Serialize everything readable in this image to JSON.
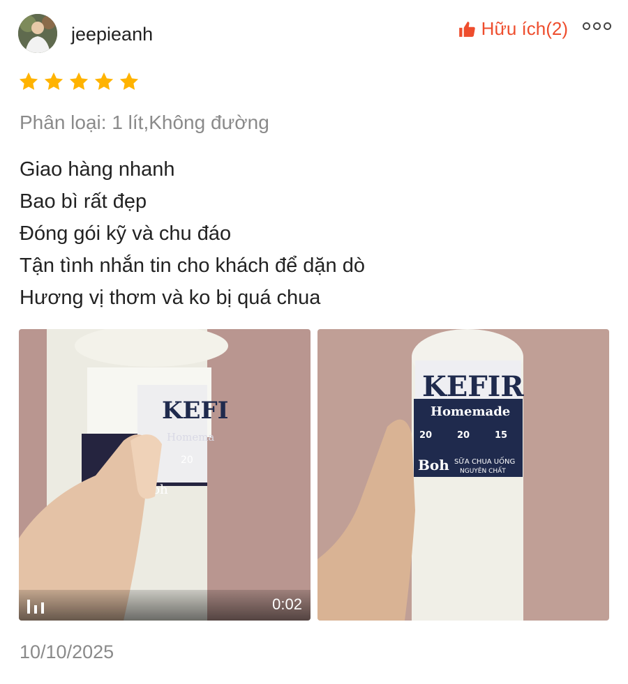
{
  "review": {
    "username": "jeepieanh",
    "helpful_label": "Hữu ích(2)",
    "rating": 5,
    "variant": "Phân loại: 1 lít,Không đường",
    "comment_lines": [
      "Giao hàng nhanh",
      "Bao bì rất đẹp",
      "Đóng gói kỹ và chu đáo",
      "Tận tình nhắn tin cho khách để dặn dò",
      "Hương vị thơm và ko bị quá chua"
    ],
    "date": "10/10/2025"
  },
  "media": {
    "video": {
      "duration": "0:02",
      "label": {
        "brand": "KEFI",
        "sub": "Homema",
        "stat": "20",
        "stat2": "20",
        "logo": "Boh"
      }
    },
    "photo": {
      "label": {
        "brand": "KEFIR",
        "sub": "Homemade",
        "stat_1": "20",
        "stat_2": "20",
        "stat_3": "15",
        "logo": "Boh",
        "product_line_1": "SỮA CHUA UỐNG",
        "product_line_2": "NGUYÊN CHẤT"
      }
    }
  },
  "colors": {
    "accent": "#ee4d2d",
    "star": "#ffb300",
    "muted_text": "#8a8a8a",
    "label_navy": "#1f2a4d"
  },
  "icons": {
    "helpful": "thumbs-up-icon",
    "more": "more-options-icon",
    "video": "video-bars-icon",
    "star": "star-icon"
  }
}
